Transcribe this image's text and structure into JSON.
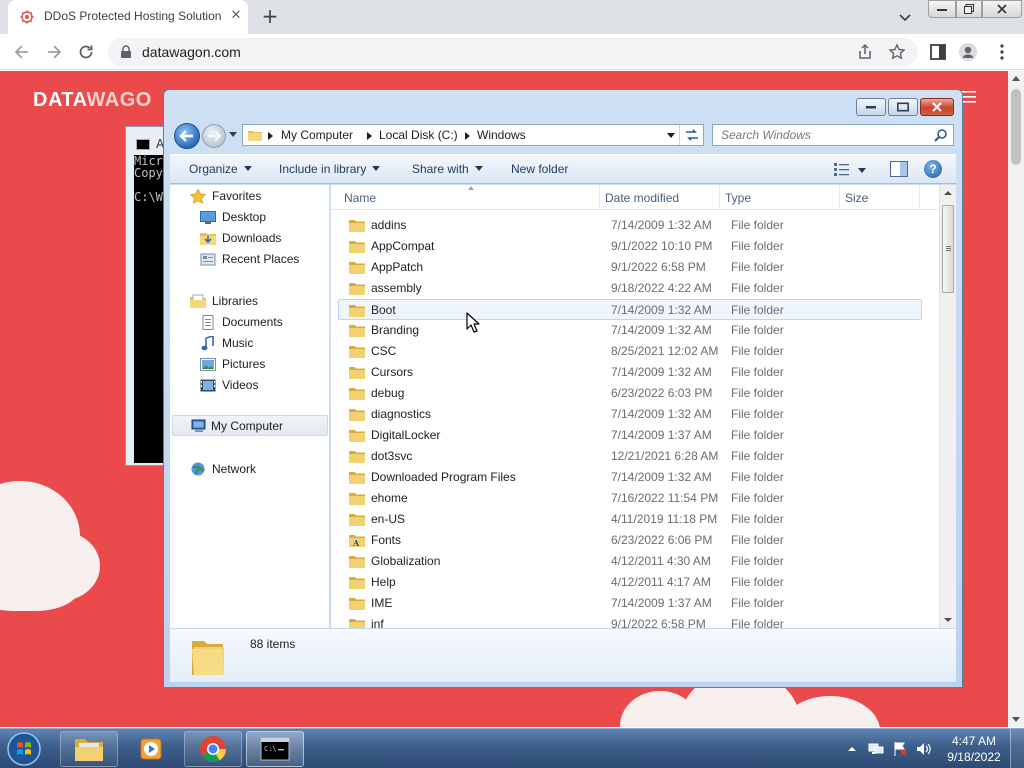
{
  "browser": {
    "tab_title": "DDoS Protected Hosting Solution",
    "url": "datawagon.com"
  },
  "website": {
    "logo_bold": "DATA",
    "logo_light": "WAGO"
  },
  "cmd_window": {
    "title_fragment": "A",
    "lines": [
      "Micr",
      "Copy",
      "",
      "C:\\W"
    ]
  },
  "explorer": {
    "address": {
      "parts": [
        "My Computer",
        "Local Disk (C:)",
        "Windows"
      ]
    },
    "search_placeholder": "Search Windows",
    "commands": {
      "organize": "Organize",
      "include_in_library": "Include in library",
      "share_with": "Share with",
      "new_folder": "New folder"
    },
    "nav": {
      "favorites": "Favorites",
      "desktop": "Desktop",
      "downloads": "Downloads",
      "recent_places": "Recent Places",
      "libraries": "Libraries",
      "documents": "Documents",
      "music": "Music",
      "pictures": "Pictures",
      "videos": "Videos",
      "my_computer": "My Computer",
      "network": "Network"
    },
    "columns": {
      "name": "Name",
      "date_modified": "Date modified",
      "type": "Type",
      "size": "Size"
    },
    "files": [
      {
        "name": "addins",
        "date": "7/14/2009 1:32 AM",
        "type": "File folder"
      },
      {
        "name": "AppCompat",
        "date": "9/1/2022 10:10 PM",
        "type": "File folder"
      },
      {
        "name": "AppPatch",
        "date": "9/1/2022 6:58 PM",
        "type": "File folder"
      },
      {
        "name": "assembly",
        "date": "9/18/2022 4:22 AM",
        "type": "File folder"
      },
      {
        "name": "Boot",
        "date": "7/14/2009 1:32 AM",
        "type": "File folder"
      },
      {
        "name": "Branding",
        "date": "7/14/2009 1:32 AM",
        "type": "File folder"
      },
      {
        "name": "CSC",
        "date": "8/25/2021 12:02 AM",
        "type": "File folder"
      },
      {
        "name": "Cursors",
        "date": "7/14/2009 1:32 AM",
        "type": "File folder"
      },
      {
        "name": "debug",
        "date": "6/23/2022 6:03 PM",
        "type": "File folder"
      },
      {
        "name": "diagnostics",
        "date": "7/14/2009 1:32 AM",
        "type": "File folder"
      },
      {
        "name": "DigitalLocker",
        "date": "7/14/2009 1:37 AM",
        "type": "File folder"
      },
      {
        "name": "dot3svc",
        "date": "12/21/2021 6:28 AM",
        "type": "File folder"
      },
      {
        "name": "Downloaded Program Files",
        "date": "7/14/2009 1:32 AM",
        "type": "File folder"
      },
      {
        "name": "ehome",
        "date": "7/16/2022 11:54 PM",
        "type": "File folder"
      },
      {
        "name": "en-US",
        "date": "4/11/2019 11:18 PM",
        "type": "File folder"
      },
      {
        "name": "Fonts",
        "date": "6/23/2022 6:06 PM",
        "type": "File folder"
      },
      {
        "name": "Globalization",
        "date": "4/12/2011 4:30 AM",
        "type": "File folder"
      },
      {
        "name": "Help",
        "date": "4/12/2011 4:17 AM",
        "type": "File folder"
      },
      {
        "name": "IME",
        "date": "7/14/2009 1:37 AM",
        "type": "File folder"
      },
      {
        "name": "inf",
        "date": "9/1/2022 6:58 PM",
        "type": "File folder"
      }
    ],
    "item_count": "88 items"
  },
  "taskbar": {
    "time": "4:47 AM",
    "date": "9/18/2022"
  },
  "colors": {
    "site_red": "#ea4a4b",
    "win_frame": "#bcd3ee",
    "taskbar": "#3d5e8a"
  }
}
